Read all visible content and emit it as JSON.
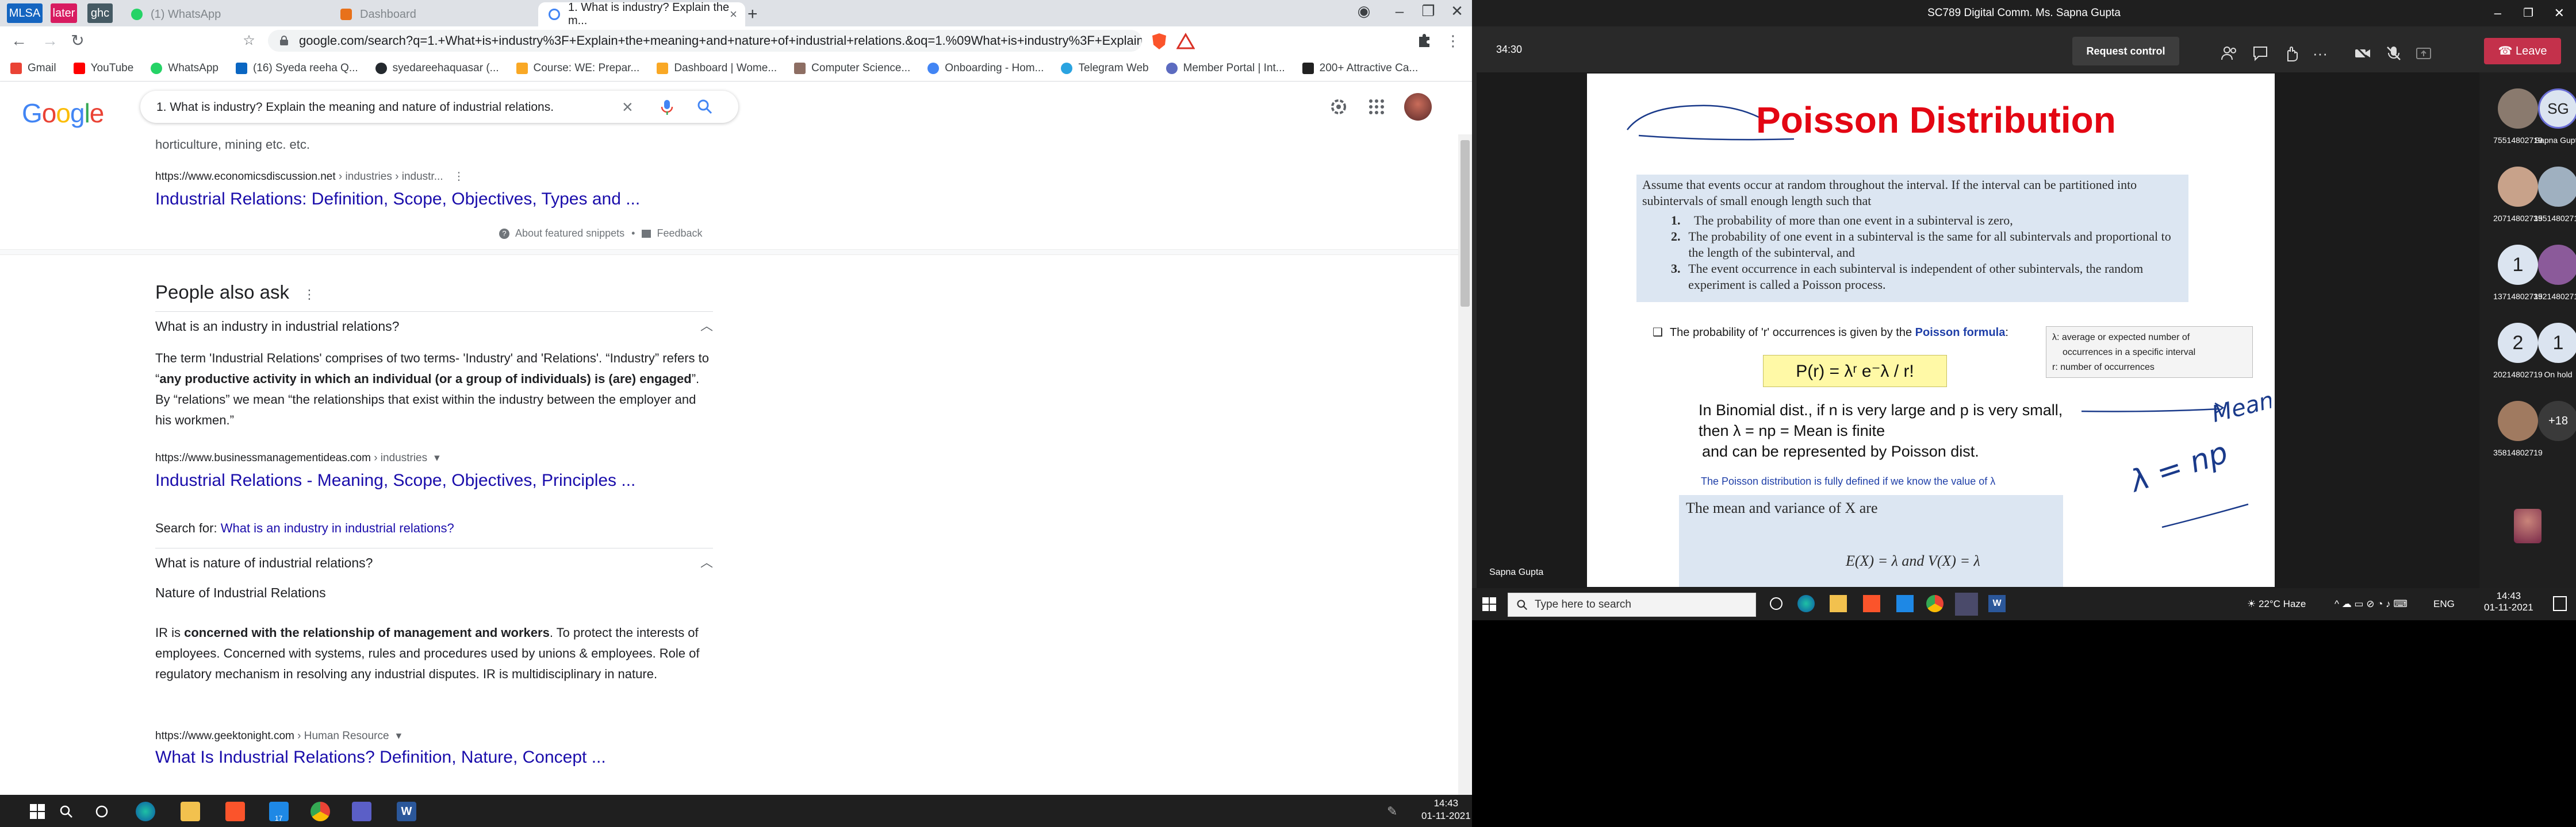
{
  "chrome": {
    "pinned_tabs": [
      {
        "label": "MLSA",
        "color": "#1565c0"
      },
      {
        "label": "later",
        "color": "#d81b60"
      },
      {
        "label": "ghc",
        "color": "#455a64"
      }
    ],
    "tabs": [
      {
        "title": "(1) WhatsApp",
        "color": "#25d366"
      },
      {
        "title": "Dashboard",
        "color": "#e8711a"
      },
      {
        "title": "1. What is industry? Explain the m...",
        "color": "#4285f4"
      }
    ],
    "new_tab": "+",
    "url": "google.com/search?q=1.+What+is+industry%3F+Explain+the+meaning+and+nature+of+industrial+relations.&oq=1.%09What+is+industry%3F+Explain+...",
    "bookmarks": [
      {
        "label": "Gmail",
        "color": "#ea4335"
      },
      {
        "label": "YouTube",
        "color": "#ff0000"
      },
      {
        "label": "WhatsApp",
        "color": "#25d366"
      },
      {
        "label": "(16) Syeda reeha Q...",
        "color": "#0a66c2"
      },
      {
        "label": "syedareehaquasar (...",
        "color": "#24292e"
      },
      {
        "label": "Course: WE: Prepar...",
        "color": "#f9a825"
      },
      {
        "label": "Dashboard | Wome...",
        "color": "#f9a825"
      },
      {
        "label": "Computer Science...",
        "color": "#8d6e63"
      },
      {
        "label": "Onboarding - Hom...",
        "color": "#4285f4"
      },
      {
        "label": "Telegram Web",
        "color": "#2aa3e0"
      },
      {
        "label": "Member Portal | Int...",
        "color": "#5c6bc0"
      },
      {
        "label": "200+ Attractive Ca...",
        "color": "#212121"
      }
    ]
  },
  "google": {
    "logo": [
      "G",
      "o",
      "o",
      "g",
      "l",
      "e"
    ],
    "logo_colors": [
      "#4285f4",
      "#ea4335",
      "#fbbc05",
      "#4285f4",
      "#34a853",
      "#ea4335"
    ],
    "query": "1. What is industry? Explain the meaning and nature of industrial relations."
  },
  "results": {
    "snippet_tail": "horticulture, mining etc. etc.",
    "r1": {
      "cite_domain": "https://www.economicsdiscussion.net",
      "cite_path": " › industries › industr...",
      "title": "Industrial Relations: Definition, Scope, Objectives, Types and ..."
    },
    "about_snippets": "About featured snippets",
    "feedback": "Feedback",
    "paa_heading": "People also ask",
    "paa1": {
      "question": "What is an industry in industrial relations?",
      "answer_pre": "The term 'Industrial Relations' comprises of two terms- 'Industry' and 'Relations'. “Industry” refers to “",
      "answer_bold": "any productive activity in which an individual (or a group of individuals) is (are) engaged",
      "answer_post": "”. By “relations” we mean “the relationships that exist within the industry between the employer and his workmen.”",
      "cite_domain": "https://www.businessmanagementideas.com",
      "cite_path": " › industries",
      "title": "Industrial Relations - Meaning, Scope, Objectives, Principles ...",
      "search_for_label": "Search for: ",
      "search_for_link": "What is an industry in industrial relations?"
    },
    "paa2": {
      "question": "What is nature of industrial relations?",
      "subhead": "Nature of Industrial Relations",
      "answer_pre": "IR is ",
      "answer_bold": "concerned with the relationship of management and workers",
      "answer_post": ". To protect the interests of employees. Concerned with systems, rules and procedures used by unions & employees. Role of regulatory mechanism in resolving any industrial disputes. IR is multidisciplinary in nature.",
      "cite_domain": "https://www.geektonight.com",
      "cite_path": " › Human Resource",
      "title": "What Is Industrial Relations? Definition, Nature, Concept ..."
    }
  },
  "taskbar_left": {
    "time": "14:43",
    "date": "01-11-2021",
    "badge": "17"
  },
  "meeting": {
    "window_title": "SC789 Digital Comm. Ms. Sapna Gupta",
    "timer": "34:30",
    "request_control": "Request control",
    "leave": "Leave",
    "presenter": "Sapna Gupta",
    "participants": [
      {
        "label": "75514802719",
        "initials": "",
        "color": "#8a7a6e"
      },
      {
        "label": "Sapna Gupta",
        "initials": "SG",
        "color": "#dbe4f0"
      },
      {
        "label": "20714802719",
        "initials": "",
        "color": "#c8a28a"
      },
      {
        "label": "35514802719",
        "initials": "",
        "color": "#9fb0c0"
      },
      {
        "label": "13714802719",
        "initials": "1",
        "color": "#dbe4f0"
      },
      {
        "label": "35214802719",
        "initials": "",
        "color": "#8b5a9a"
      },
      {
        "label": "20214802719",
        "initials": "2",
        "color": "#dbe4f0"
      },
      {
        "label": "On hold",
        "initials": "1",
        "color": "#dbe4f0"
      },
      {
        "label": "35814802719",
        "initials": "",
        "color": "#a07a60"
      },
      {
        "label": "",
        "initials": "+18",
        "color": "#3a3a3a"
      }
    ]
  },
  "slide": {
    "title": "Poisson Distribution",
    "intro": "Assume that events occur at random throughout the interval. If the interval can be partitioned into subintervals of small enough length such that",
    "points": [
      {
        "n": "1.",
        "text": "The probability of more than one event in a subinterval is zero,"
      },
      {
        "n": "2.",
        "text": "The probability of one event in a subinterval is the same for all subintervals and proportional to the length of the subinterval, and"
      },
      {
        "n": "3.",
        "text": "The event occurrence in each subinterval is independent of other subintervals, the random experiment is called a Poisson process."
      }
    ],
    "prob_pre": "The probability of 'r' occurrences is given by the ",
    "prob_bold": "Poisson formula",
    "prob_post": ":",
    "formula": "P(r) = λʳ e⁻λ / r!",
    "legend": [
      "λ: average or expected number of",
      "occurrences in a specific interval",
      "r: number of occurrences"
    ],
    "binom": [
      "In Binomial dist., if n is very large and p is very small,",
      "then λ = np = Mean is finite",
      "and can be represented by Poisson dist."
    ],
    "poisson_def": "The Poisson distribution is fully defined if we know the value of λ",
    "mean_var_label": "The mean and variance of X are",
    "mean_var_formula": "E(X) = λ       and       V(X) = λ",
    "handwriting": "Mean = np"
  },
  "taskbar_right": {
    "search_placeholder": "Type here to search",
    "weather": "22°C  Haze",
    "lang": "ENG",
    "time": "14:43",
    "date": "01-11-2021"
  }
}
